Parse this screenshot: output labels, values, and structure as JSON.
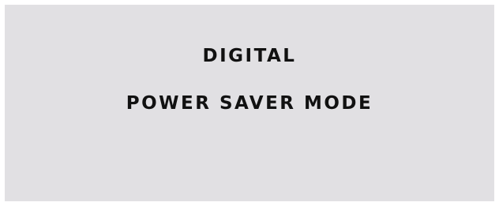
{
  "screen": {
    "line1": "DIGITAL",
    "line2": "POWER SAVER MODE",
    "background_color": "#e1e0e3",
    "text_color": "#111111"
  }
}
